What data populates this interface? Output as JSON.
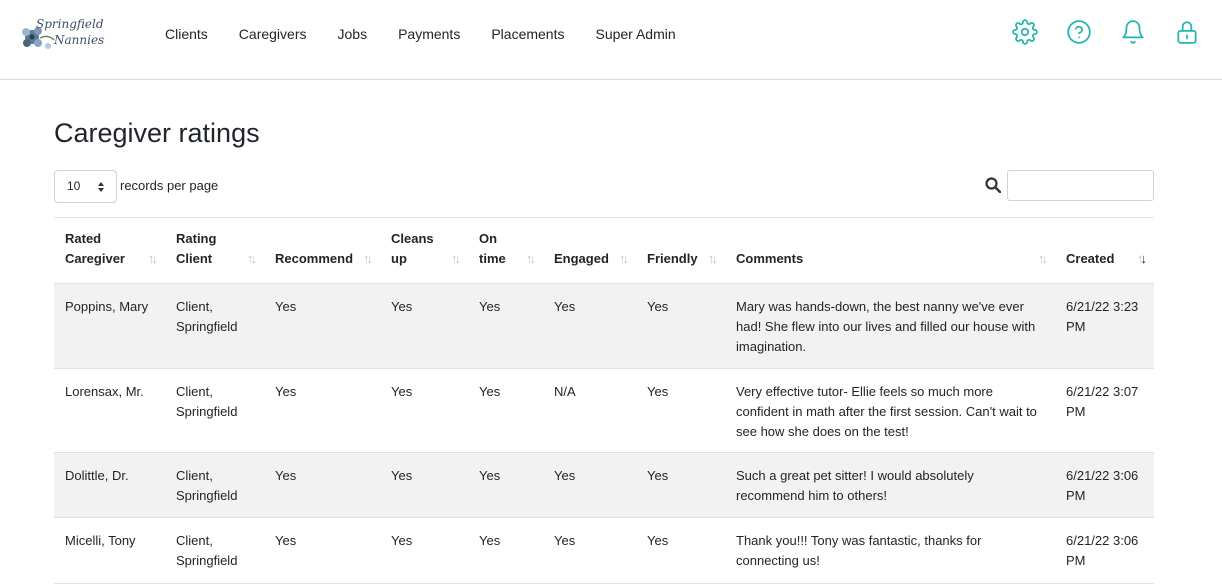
{
  "brand": {
    "logo_line1": "Springfield",
    "logo_line2": "Nannies"
  },
  "nav": {
    "links": [
      "Clients",
      "Caregivers",
      "Jobs",
      "Payments",
      "Placements",
      "Super Admin"
    ],
    "icons": [
      "gear-icon",
      "help-icon",
      "bell-icon",
      "lock-icon"
    ],
    "accent_color": "#1fb5ad"
  },
  "page": {
    "title": "Caregiver ratings"
  },
  "controls": {
    "page_length_value": "10",
    "page_length_label": "records per page",
    "search_value": ""
  },
  "table": {
    "columns": [
      {
        "line1": "Rated",
        "line2": "Caregiver"
      },
      {
        "line1": "Rating",
        "line2": "Client"
      },
      {
        "line1": "",
        "line2": "Recommend"
      },
      {
        "line1": "Cleans",
        "line2": "up"
      },
      {
        "line1": "On",
        "line2": "time"
      },
      {
        "line1": "",
        "line2": "Engaged"
      },
      {
        "line1": "",
        "line2": "Friendly"
      },
      {
        "line1": "",
        "line2": "Comments"
      },
      {
        "line1": "",
        "line2": "Created"
      }
    ],
    "sorted_column": "Created",
    "sort_direction": "descending",
    "rows": [
      {
        "caregiver": "Poppins, Mary",
        "client_line1": "Client,",
        "client_line2": "Springfield",
        "recommend": "Yes",
        "cleans_up": "Yes",
        "on_time": "Yes",
        "engaged": "Yes",
        "friendly": "Yes",
        "comments": "Mary was hands-down, the best nanny we've ever had! She flew into our lives and filled our house with imagination.",
        "created_line1": "6/21/22 3:23",
        "created_line2": "PM"
      },
      {
        "caregiver": "Lorensax, Mr.",
        "client_line1": "Client,",
        "client_line2": "Springfield",
        "recommend": "Yes",
        "cleans_up": "Yes",
        "on_time": "Yes",
        "engaged": "N/A",
        "friendly": "Yes",
        "comments": "Very effective tutor- Ellie feels so much more confident in math after the first session. Can't wait to see how she does on the test!",
        "created_line1": "6/21/22 3:07",
        "created_line2": "PM"
      },
      {
        "caregiver": "Dolittle, Dr.",
        "client_line1": "Client,",
        "client_line2": "Springfield",
        "recommend": "Yes",
        "cleans_up": "Yes",
        "on_time": "Yes",
        "engaged": "Yes",
        "friendly": "Yes",
        "comments": "Such a great pet sitter! I would absolutely recommend him to others!",
        "created_line1": "6/21/22 3:06",
        "created_line2": "PM"
      },
      {
        "caregiver": "Micelli, Tony",
        "client_line1": "Client,",
        "client_line2": "Springfield",
        "recommend": "Yes",
        "cleans_up": "Yes",
        "on_time": "Yes",
        "engaged": "Yes",
        "friendly": "Yes",
        "comments": "Thank you!!! Tony was fantastic, thanks for connecting us!",
        "created_line1": "6/21/22 3:06",
        "created_line2": "PM"
      }
    ]
  }
}
